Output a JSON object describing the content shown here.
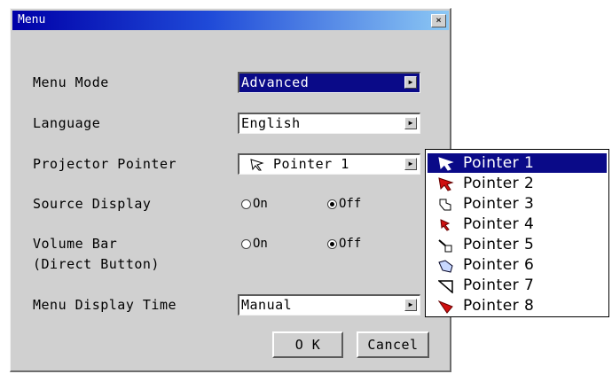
{
  "window": {
    "title": "Menu",
    "close_symbol": "×"
  },
  "rows": {
    "menu_mode": {
      "label": "Menu Mode",
      "value": "Advanced"
    },
    "language": {
      "label": "Language",
      "value": "English"
    },
    "projector_pointer": {
      "label": "Projector Pointer",
      "value": "Pointer 1"
    },
    "source_display": {
      "label": "Source Display",
      "on": "On",
      "off": "Off",
      "selected": "Off"
    },
    "volume_bar": {
      "label_line1": "Volume Bar",
      "label_line2": "(Direct Button)",
      "on": "On",
      "off": "Off",
      "selected": "Off"
    },
    "menu_display_time": {
      "label": "Menu Display Time",
      "value": "Manual"
    }
  },
  "buttons": {
    "ok": "O K",
    "cancel": "Cancel"
  },
  "pointer_list": {
    "selected_index": 0,
    "items": [
      "Pointer 1",
      "Pointer 2",
      "Pointer 3",
      "Pointer 4",
      "Pointer 5",
      "Pointer 6",
      "Pointer 7",
      "Pointer 8"
    ],
    "icons": [
      "arrow-pointer-icon",
      "red-arrow-pointer-icon",
      "hand-pointer-icon",
      "red-arrow-small-icon",
      "pen-pointer-icon",
      "hand-point-icon",
      "outline-triangle-pointer-icon",
      "red-triangle-pointer-icon"
    ]
  },
  "colors": {
    "selection": "#0a0a88",
    "titlebar_start": "#0000a8",
    "titlebar_end": "#8cc8f4"
  }
}
